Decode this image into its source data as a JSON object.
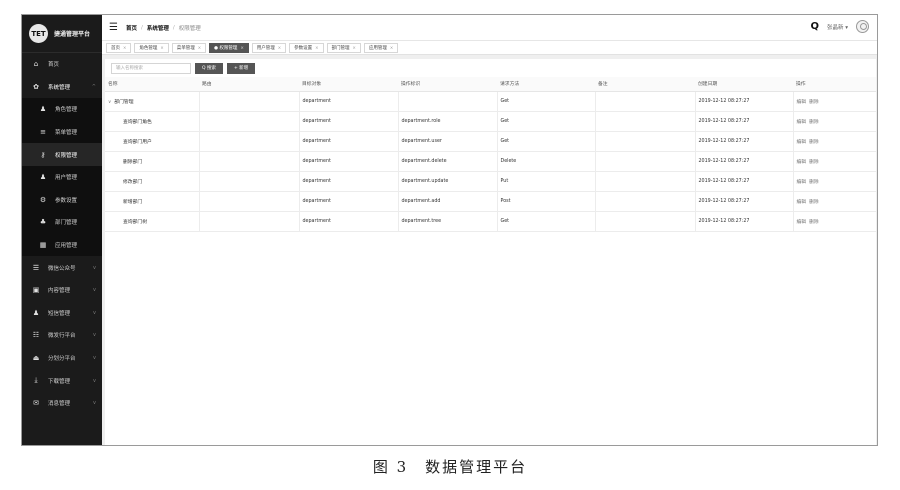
{
  "app": {
    "logo_mark": "TET",
    "title": "捷通管理平台"
  },
  "sidebar": {
    "items": [
      {
        "label": "首页",
        "icon": "home-icon",
        "glyph": "⌂",
        "level": 0,
        "chev": ""
      },
      {
        "label": "系统管理",
        "icon": "gear-icon",
        "glyph": "✿",
        "level": 0,
        "chev": "^"
      },
      {
        "label": "角色管理",
        "icon": "person-icon",
        "glyph": "♟",
        "level": 1,
        "chev": ""
      },
      {
        "label": "菜单管理",
        "icon": "menu-icon",
        "glyph": "≡",
        "level": 1,
        "chev": ""
      },
      {
        "label": "权限管理",
        "icon": "key-icon",
        "glyph": "⚷",
        "level": 1,
        "chev": ""
      },
      {
        "label": "用户管理",
        "icon": "user-icon",
        "glyph": "♟",
        "level": 1,
        "chev": ""
      },
      {
        "label": "参数设置",
        "icon": "settings-icon",
        "glyph": "⚙",
        "level": 1,
        "chev": ""
      },
      {
        "label": "部门管理",
        "icon": "org-icon",
        "glyph": "♣",
        "level": 1,
        "chev": ""
      },
      {
        "label": "应用管理",
        "icon": "apps-icon",
        "glyph": "▦",
        "level": 1,
        "chev": ""
      },
      {
        "label": "微信公众号",
        "icon": "list-icon",
        "glyph": "☰",
        "level": 0,
        "chev": "v"
      },
      {
        "label": "内容管理",
        "icon": "content-icon",
        "glyph": "▣",
        "level": 0,
        "chev": "v"
      },
      {
        "label": "短信管理",
        "icon": "message-icon",
        "glyph": "♟",
        "level": 0,
        "chev": "v"
      },
      {
        "label": "微发行平台",
        "icon": "publish-icon",
        "glyph": "☷",
        "level": 0,
        "chev": "v"
      },
      {
        "label": "分划分平台",
        "icon": "platform-icon",
        "glyph": "⏏",
        "level": 0,
        "chev": "v"
      },
      {
        "label": "下载管理",
        "icon": "download-icon",
        "glyph": "⤓",
        "level": 0,
        "chev": "v"
      },
      {
        "label": "消息管理",
        "icon": "inbox-icon",
        "glyph": "✉",
        "level": 0,
        "chev": "v"
      }
    ]
  },
  "header": {
    "breadcrumb": [
      "首页",
      "系统管理",
      "权限管理"
    ],
    "user_name": "张晶新 ▾"
  },
  "tabs": [
    {
      "label": "首页",
      "active": false
    },
    {
      "label": "角色管理",
      "active": false
    },
    {
      "label": "菜单管理",
      "active": false
    },
    {
      "label": "● 权限管理",
      "active": true
    },
    {
      "label": "用户管理",
      "active": false
    },
    {
      "label": "参数设置",
      "active": false
    },
    {
      "label": "部门管理",
      "active": false
    },
    {
      "label": "应用管理",
      "active": false
    }
  ],
  "toolbar": {
    "search_placeholder": "输入名称搜索",
    "search_button": "Q 搜索",
    "add_button": "+ 新增"
  },
  "table": {
    "columns": [
      "名称",
      "路由",
      "目标对象",
      "操作标识",
      "请求方法",
      "备注",
      "创建日期",
      "操作"
    ],
    "rows": [
      {
        "name": "部门管理",
        "is_parent": true,
        "route": "",
        "target": "department",
        "action": "",
        "method": "Get",
        "remark": "",
        "created": "2019-12-12 08:27:27",
        "edit": "编辑",
        "delete": "删除"
      },
      {
        "name": "查询部门角色",
        "is_parent": false,
        "route": "",
        "target": "department",
        "action": "department.role",
        "method": "Get",
        "remark": "",
        "created": "2019-12-12 08:27:27",
        "edit": "编辑",
        "delete": "删除"
      },
      {
        "name": "查询部门用户",
        "is_parent": false,
        "route": "",
        "target": "department",
        "action": "department.user",
        "method": "Get",
        "remark": "",
        "created": "2019-12-12 08:27:27",
        "edit": "编辑",
        "delete": "删除"
      },
      {
        "name": "删除部门",
        "is_parent": false,
        "route": "",
        "target": "department",
        "action": "department.delete",
        "method": "Delete",
        "remark": "",
        "created": "2019-12-12 08:27:27",
        "edit": "编辑",
        "delete": "删除"
      },
      {
        "name": "修改部门",
        "is_parent": false,
        "route": "",
        "target": "department",
        "action": "department.update",
        "method": "Put",
        "remark": "",
        "created": "2019-12-12 08:27:27",
        "edit": "编辑",
        "delete": "删除"
      },
      {
        "name": "新增部门",
        "is_parent": false,
        "route": "",
        "target": "department",
        "action": "department.add",
        "method": "Post",
        "remark": "",
        "created": "2019-12-12 08:27:27",
        "edit": "编辑",
        "delete": "删除"
      },
      {
        "name": "查询部门树",
        "is_parent": false,
        "route": "",
        "target": "department",
        "action": "department.tree",
        "method": "Get",
        "remark": "",
        "created": "2019-12-12 08:27:27",
        "edit": "编辑",
        "delete": "删除"
      }
    ]
  },
  "caption": "图 3　数据管理平台"
}
